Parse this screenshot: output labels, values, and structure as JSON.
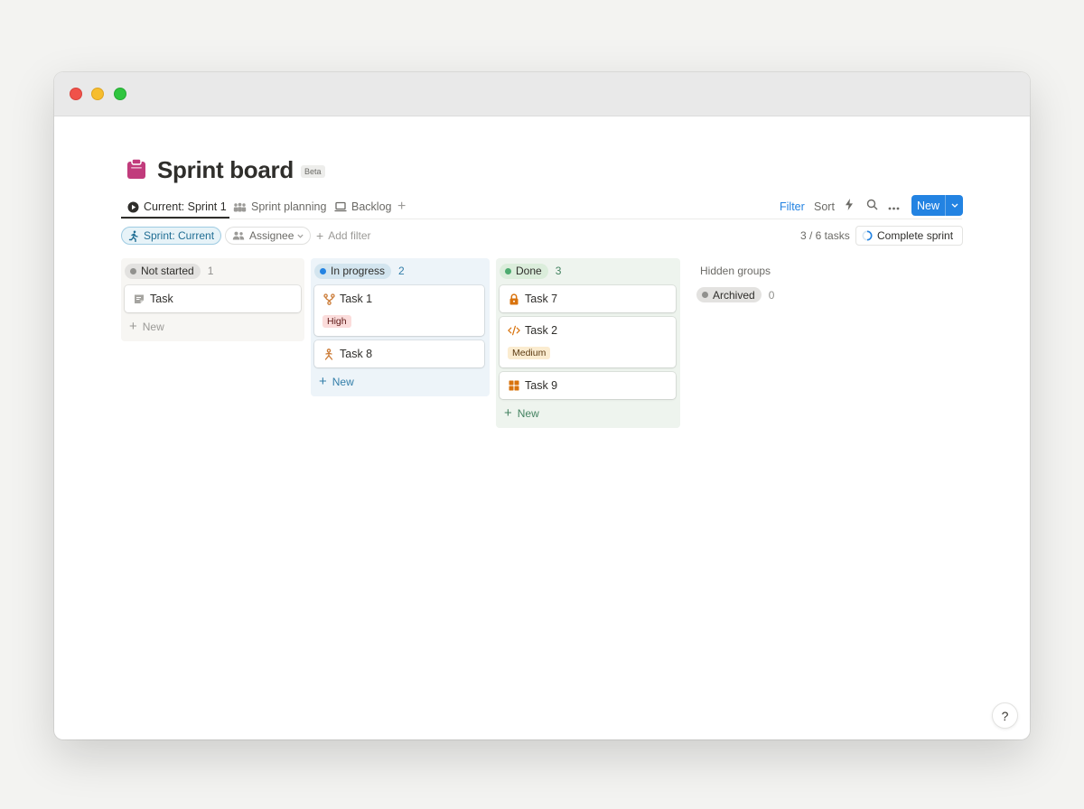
{
  "page": {
    "title": "Sprint board",
    "badge": "Beta"
  },
  "tabs": [
    {
      "label": "Current: Sprint 1",
      "icon": "play-circle-icon",
      "active": true
    },
    {
      "label": "Sprint planning",
      "icon": "people-icon",
      "active": false
    },
    {
      "label": "Backlog",
      "icon": "laptop-icon",
      "active": false
    }
  ],
  "toolbar": {
    "filter_label": "Filter",
    "sort_label": "Sort",
    "new_label": "New"
  },
  "filters": {
    "sprint_chip": "Sprint: Current",
    "assignee_chip": "Assignee",
    "add_filter": "Add filter",
    "tasks_count": "3 / 6 tasks",
    "complete_sprint": "Complete sprint"
  },
  "columns": [
    {
      "status": "Not started",
      "count": "1",
      "dot_color": "#91918e",
      "pill_bg": "#e3e2e0",
      "count_color": "#91918e",
      "cards": [
        {
          "title": "Task",
          "icon": "document-icon"
        }
      ],
      "new_label": "New"
    },
    {
      "status": "In progress",
      "count": "2",
      "dot_color": "#2383e2",
      "pill_bg": "#d3e5ef",
      "count_color": "#337ea9",
      "cards": [
        {
          "title": "Task 1",
          "icon": "fork-icon",
          "tag": "High"
        },
        {
          "title": "Task 8",
          "icon": "person-icon"
        }
      ],
      "new_label": "New"
    },
    {
      "status": "Done",
      "count": "3",
      "dot_color": "#4dab6f",
      "pill_bg": "#dbeddb",
      "count_color": "#448361",
      "cards": [
        {
          "title": "Task 7",
          "icon": "lock-icon"
        },
        {
          "title": "Task 2",
          "icon": "code-icon",
          "tag": "Medium"
        },
        {
          "title": "Task 9",
          "icon": "grid-icon"
        }
      ],
      "new_label": "New"
    }
  ],
  "hidden": {
    "heading": "Hidden groups",
    "archived_label": "Archived",
    "archived_count": "0"
  },
  "help": "?"
}
